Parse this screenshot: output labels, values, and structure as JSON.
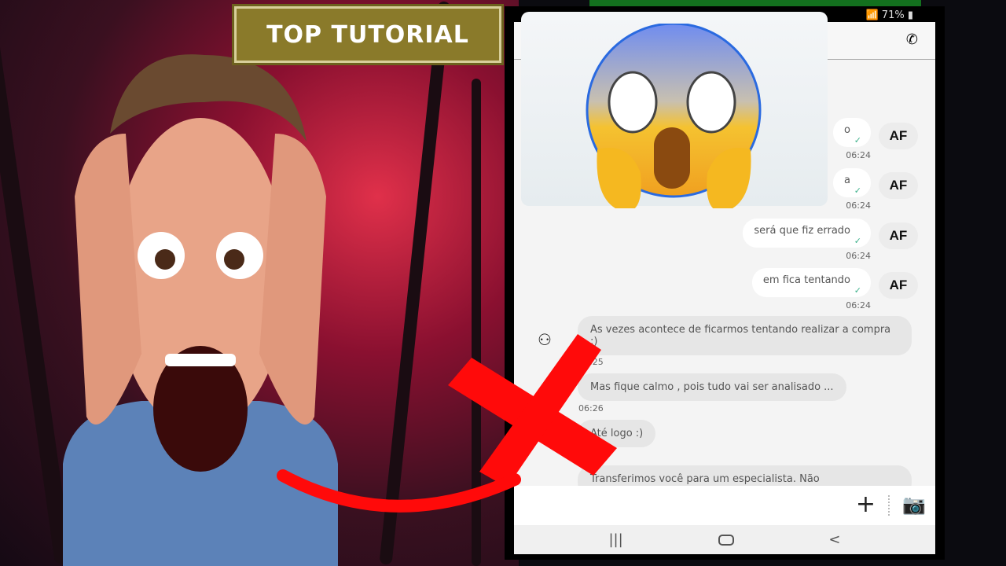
{
  "banner": {
    "title": "TOP TUTORIAL"
  },
  "status_bar": {
    "battery": "71%"
  },
  "chat": {
    "outgoing": [
      {
        "text": "o",
        "time": "06:24",
        "avatar": "AF"
      },
      {
        "text": "a",
        "time": "06:24",
        "avatar": "AF"
      },
      {
        "text": "será que fiz errado",
        "time": "06:24",
        "avatar": "AF"
      },
      {
        "text": "em fica tentando",
        "time": "06:24",
        "avatar": "AF"
      }
    ],
    "incoming": [
      {
        "text": "As vezes acontece de ficarmos tentando realizar a compra :)",
        "time": "06:25"
      },
      {
        "text": "Mas fique calmo , pois tudo vai ser analisado ...",
        "time": "06:26"
      },
      {
        "text": "Até logo :)",
        "time": ""
      },
      {
        "text": "Transferimos você para um especialista. Não",
        "time": ""
      }
    ]
  },
  "icons": [
    "phone-call-icon",
    "plus-icon",
    "camera-icon",
    "recent-apps-icon",
    "home-icon",
    "back-icon",
    "check-icon",
    "agent-avatar-icon",
    "screaming-emoji",
    "red-x-mark"
  ],
  "colors": {
    "banner": "#8a7a2a",
    "x_mark": "#ff0a0a",
    "check": "#3cb08a"
  }
}
